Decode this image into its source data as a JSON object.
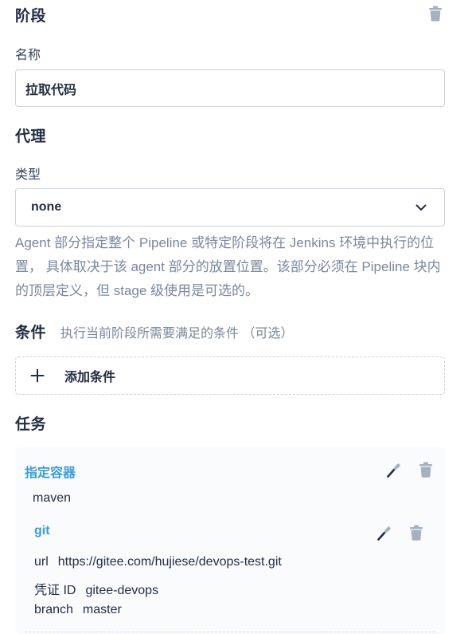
{
  "stage": {
    "title": "阶段",
    "name_label": "名称",
    "name_value": "拉取代码"
  },
  "agent": {
    "title": "代理",
    "type_label": "类型",
    "type_value": "none",
    "description": "Agent 部分指定整个 Pipeline 或特定阶段将在 Jenkins 环境中执行的位置， 具体取决于该 agent 部分的放置位置。该部分必须在 Pipeline 块内的顶层定义，但 stage 级使用是可选的。"
  },
  "conditions": {
    "title": "条件",
    "hint": "执行当前阶段所需要满足的条件 （可选）",
    "add_label": "添加条件"
  },
  "tasks": {
    "title": "任务",
    "container": {
      "title": "指定容器",
      "value": "maven"
    },
    "git": {
      "title": "git",
      "rows": [
        {
          "key": "url",
          "value": "https://gitee.com/hujiese/devops-test.git"
        },
        {
          "key": "凭证 ID",
          "value": "gitee-devops"
        },
        {
          "key": "branch",
          "value": "master"
        }
      ]
    }
  },
  "colors": {
    "accent": "#3c9bd6",
    "text": "#242e42",
    "muted": "#79879c",
    "border": "#ccd3db",
    "icon": "#a5b1bf"
  },
  "icons": [
    "trash-icon",
    "chevron-down-icon",
    "plus-icon",
    "wrench-icon"
  ]
}
